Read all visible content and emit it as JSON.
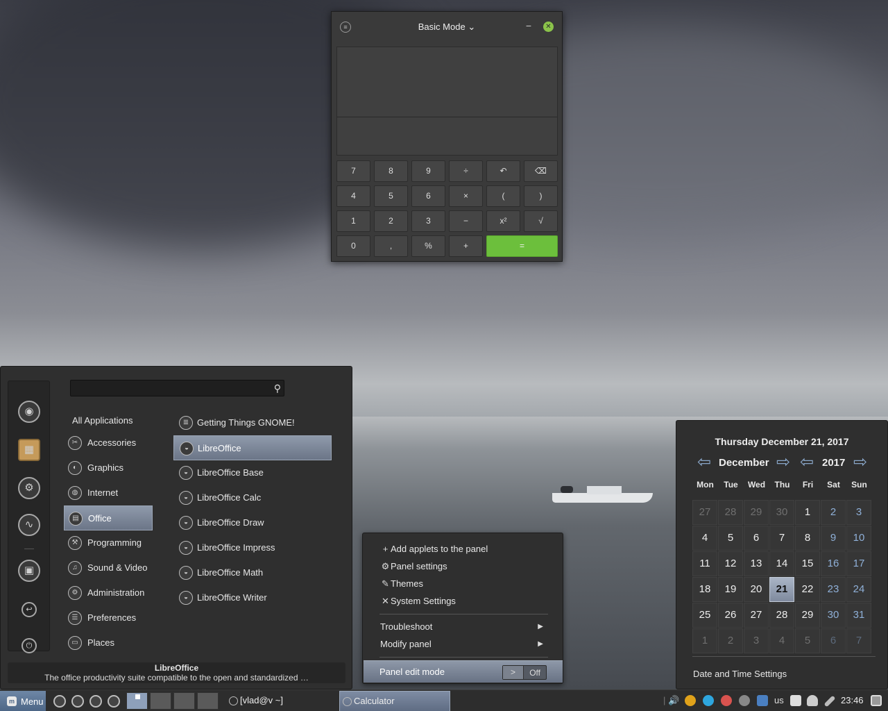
{
  "calculator": {
    "mode_label": "Basic Mode",
    "keys": [
      "7",
      "8",
      "9",
      "÷",
      "↶",
      "⌫",
      "4",
      "5",
      "6",
      "×",
      "(",
      ")",
      "1",
      "2",
      "3",
      "−",
      "x²",
      "√",
      "0",
      ",",
      "%",
      "+",
      "="
    ]
  },
  "menu": {
    "all_label": "All Applications",
    "categories": [
      "Accessories",
      "Graphics",
      "Internet",
      "Office",
      "Programming",
      "Sound & Video",
      "Administration",
      "Preferences",
      "Places"
    ],
    "selected_category": "Office",
    "apps": [
      "Getting Things GNOME!",
      "LibreOffice",
      "LibreOffice Base",
      "LibreOffice Calc",
      "LibreOffice Draw",
      "LibreOffice Impress",
      "LibreOffice Math",
      "LibreOffice Writer"
    ],
    "selected_app": "LibreOffice",
    "desc_title": "LibreOffice",
    "desc_text": "The office productivity suite compatible to the open and standardized …"
  },
  "context_menu": {
    "add_applets": "Add applets to the panel",
    "panel_settings": "Panel settings",
    "themes": "Themes",
    "system_settings": "System Settings",
    "troubleshoot": "Troubleshoot",
    "modify_panel": "Modify panel",
    "edit_mode": "Panel edit mode",
    "toggle_knob": ">",
    "toggle_state": "Off"
  },
  "calendar": {
    "header": "Thursday December 21, 2017",
    "month": "December",
    "year": "2017",
    "days_of_week": [
      "Mon",
      "Tue",
      "Wed",
      "Thu",
      "Fri",
      "Sat",
      "Sun"
    ],
    "days": [
      "27",
      "28",
      "29",
      "30",
      "1",
      "2",
      "3",
      "4",
      "5",
      "6",
      "7",
      "8",
      "9",
      "10",
      "11",
      "12",
      "13",
      "14",
      "15",
      "16",
      "17",
      "18",
      "19",
      "20",
      "21",
      "22",
      "23",
      "24",
      "25",
      "26",
      "27",
      "28",
      "29",
      "30",
      "31",
      "1",
      "2",
      "3",
      "4",
      "5",
      "6",
      "7"
    ],
    "today": "21",
    "settings_label": "Date and Time Settings"
  },
  "panel": {
    "menu_label": "Menu",
    "tasks": [
      "[vlad@v ~]",
      "Calculator"
    ],
    "keyboard_layout": "us",
    "clock": "23:46"
  }
}
